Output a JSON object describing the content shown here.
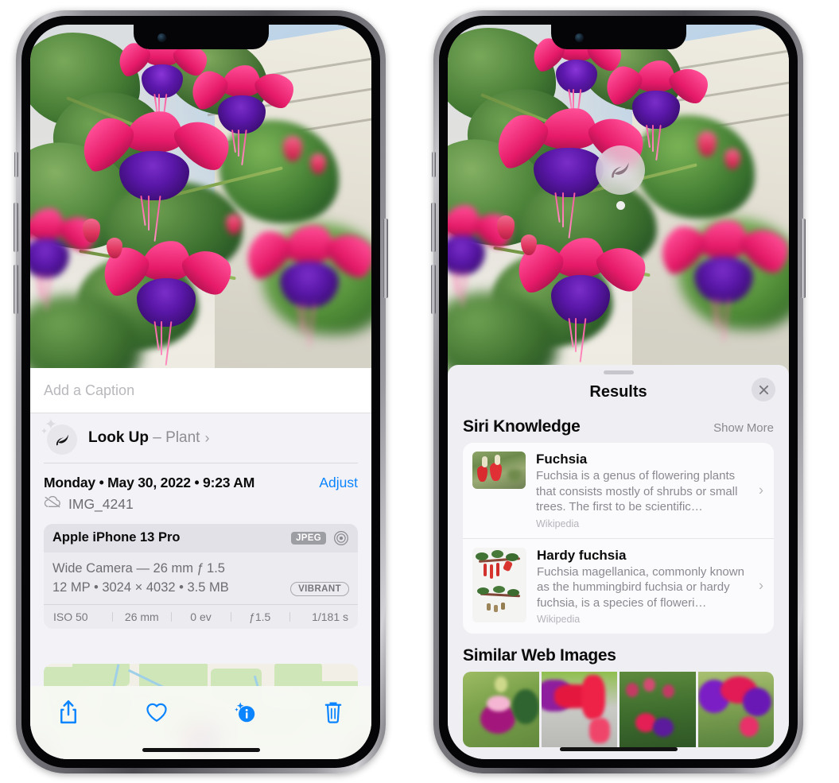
{
  "left_phone": {
    "name": "photos-detail-view",
    "photo": {
      "alt": "fuchsia-flowers-hanging-basket"
    },
    "caption": {
      "placeholder": "Add a Caption",
      "value": ""
    },
    "look_up": {
      "icon": "leaf-icon",
      "sparkle_icon": "sparkles-icon",
      "title": "Look Up",
      "separator": "–",
      "subject": "Plant",
      "chevron": "›"
    },
    "meta": {
      "date": "Monday • May 30, 2022 • 9:23 AM",
      "adjust_label": "Adjust",
      "cloud_icon": "cloud-slash-icon",
      "filename": "IMG_4241"
    },
    "exif": {
      "device": "Apple iPhone 13 Pro",
      "format_badge": "JPEG",
      "aperture_icon": "aperture-icon",
      "lens_line": "Wide Camera — 26 mm ƒ 1.5",
      "specs_line": "12 MP • 3024 × 4032 • 3.5 MB",
      "style_badge": "VIBRANT",
      "footer": [
        "ISO 50",
        "26 mm",
        "0 ev",
        "ƒ1.5",
        "1/181 s"
      ]
    },
    "map": {
      "name": "location-map",
      "pin": "photo-pin-thumbnail"
    },
    "toolbar": [
      {
        "name": "share-button",
        "icon": "share-icon"
      },
      {
        "name": "favorite-button",
        "icon": "heart-icon"
      },
      {
        "name": "info-button",
        "icon": "info-sparkle-icon"
      },
      {
        "name": "delete-button",
        "icon": "trash-icon"
      }
    ]
  },
  "right_phone": {
    "name": "visual-look-up-results",
    "badge": {
      "icon": "leaf-icon",
      "label": "visual-look-up-badge"
    },
    "sheet": {
      "grabber": "sheet-grabber",
      "title": "Results",
      "close_icon": "close-icon"
    },
    "siri_knowledge": {
      "title": "Siri Knowledge",
      "action": "Show More",
      "cards": [
        {
          "title": "Fuchsia",
          "description": "Fuchsia is a genus of flowering plants that consists mostly of shrubs or small trees. The first to be scientific…",
          "source": "Wikipedia",
          "thumb": "fuchsia-red-flowers-thumbnail",
          "chevron": "›"
        },
        {
          "title": "Hardy fuchsia",
          "description": "Fuchsia magellanica, commonly known as the hummingbird fuchsia or hardy fuchsia, is a species of floweri…",
          "source": "Wikipedia",
          "thumb": "hardy-fuchsia-specimen-thumbnail",
          "chevron": "›"
        }
      ]
    },
    "similar_web_images": {
      "title": "Similar Web Images",
      "items": [
        {
          "name": "web-image-1",
          "alt": "magenta-fuchsia-with-leaves"
        },
        {
          "name": "web-image-2",
          "alt": "red-fuchsia-closeup"
        },
        {
          "name": "web-image-3",
          "alt": "fuchsia-buds-on-bush"
        },
        {
          "name": "web-image-4",
          "alt": "purple-pink-double-fuchsia"
        }
      ]
    }
  },
  "colors": {
    "accent_blue": "#0a84ff",
    "sheet_bg": "#eeeef3",
    "card_bg": "#fbfbfd",
    "info_bg": "#f2f2f7",
    "secondary_text": "#8a8a90"
  }
}
